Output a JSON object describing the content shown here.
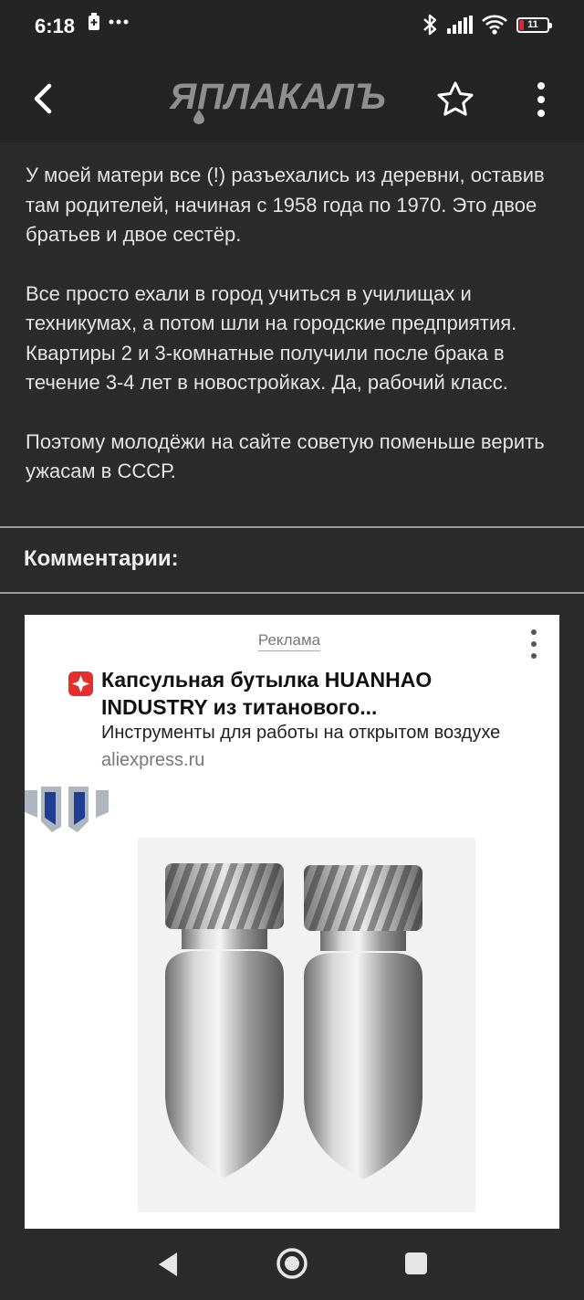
{
  "status_bar": {
    "time": "6:18",
    "battery_level": "11",
    "icons_left": [
      "battery-saver-icon",
      "more-notifications-icon"
    ],
    "icons_right": [
      "bluetooth-icon",
      "signal-icon",
      "wifi-icon",
      "battery-icon"
    ],
    "battery_low_color": "#e0262c"
  },
  "app_bar": {
    "logo_text": "ЯПЛАКАЛЪ",
    "icons": [
      "back-arrow-icon",
      "star-icon",
      "more-vertical-icon"
    ]
  },
  "post": {
    "paragraphs": [
      "У моей матери все (!) разъехались из деревни, оставив там родителей, начиная с 1958 года по 1970. Это двое братьев и двое сестёр.",
      "Все просто ехали в город учиться в училищах и техникумах, а потом шли на городские предприятия. Квартиры 2 и 3-комнатные получили после брака в течение 3-4 лет в новостройках. Да, рабочий класс.",
      "Поэтому молодёжи на сайте советую поменьше верить ужасам в СССР."
    ]
  },
  "comments": {
    "title": "Комментарии:"
  },
  "ad": {
    "label": "Реклама",
    "title": "Капсульная бутылка HUANHAO INDUSTRY из титанового...",
    "description": "Инструменты для работы на открытом воздухе",
    "domain": "aliexpress.ru",
    "brand_color": "#e62e2b"
  },
  "nav_bar": {
    "icons": [
      "nav-back-icon",
      "nav-home-icon",
      "nav-recents-icon"
    ]
  }
}
